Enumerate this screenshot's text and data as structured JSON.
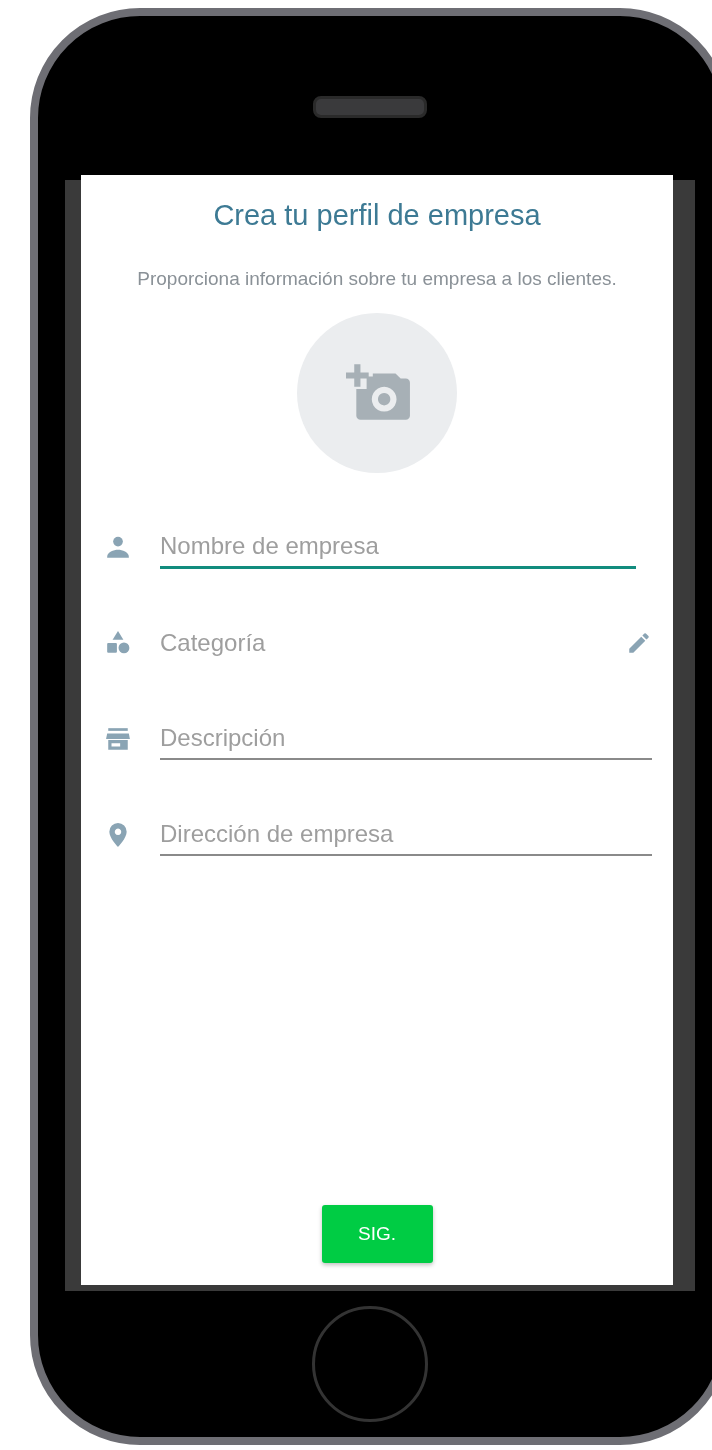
{
  "title": "Crea tu perfil de empresa",
  "subtitle": "Proporciona información sobre tu empresa a los clientes.",
  "fields": [
    {
      "kind": "text",
      "placeholder": "Nombre de empresa",
      "focused": true
    },
    {
      "kind": "picker",
      "placeholder": "Categoría"
    },
    {
      "kind": "text",
      "placeholder": "Descripción",
      "focused": false
    },
    {
      "kind": "text",
      "placeholder": "Dirección de empresa",
      "focused": false
    }
  ],
  "next_button": "SIG."
}
